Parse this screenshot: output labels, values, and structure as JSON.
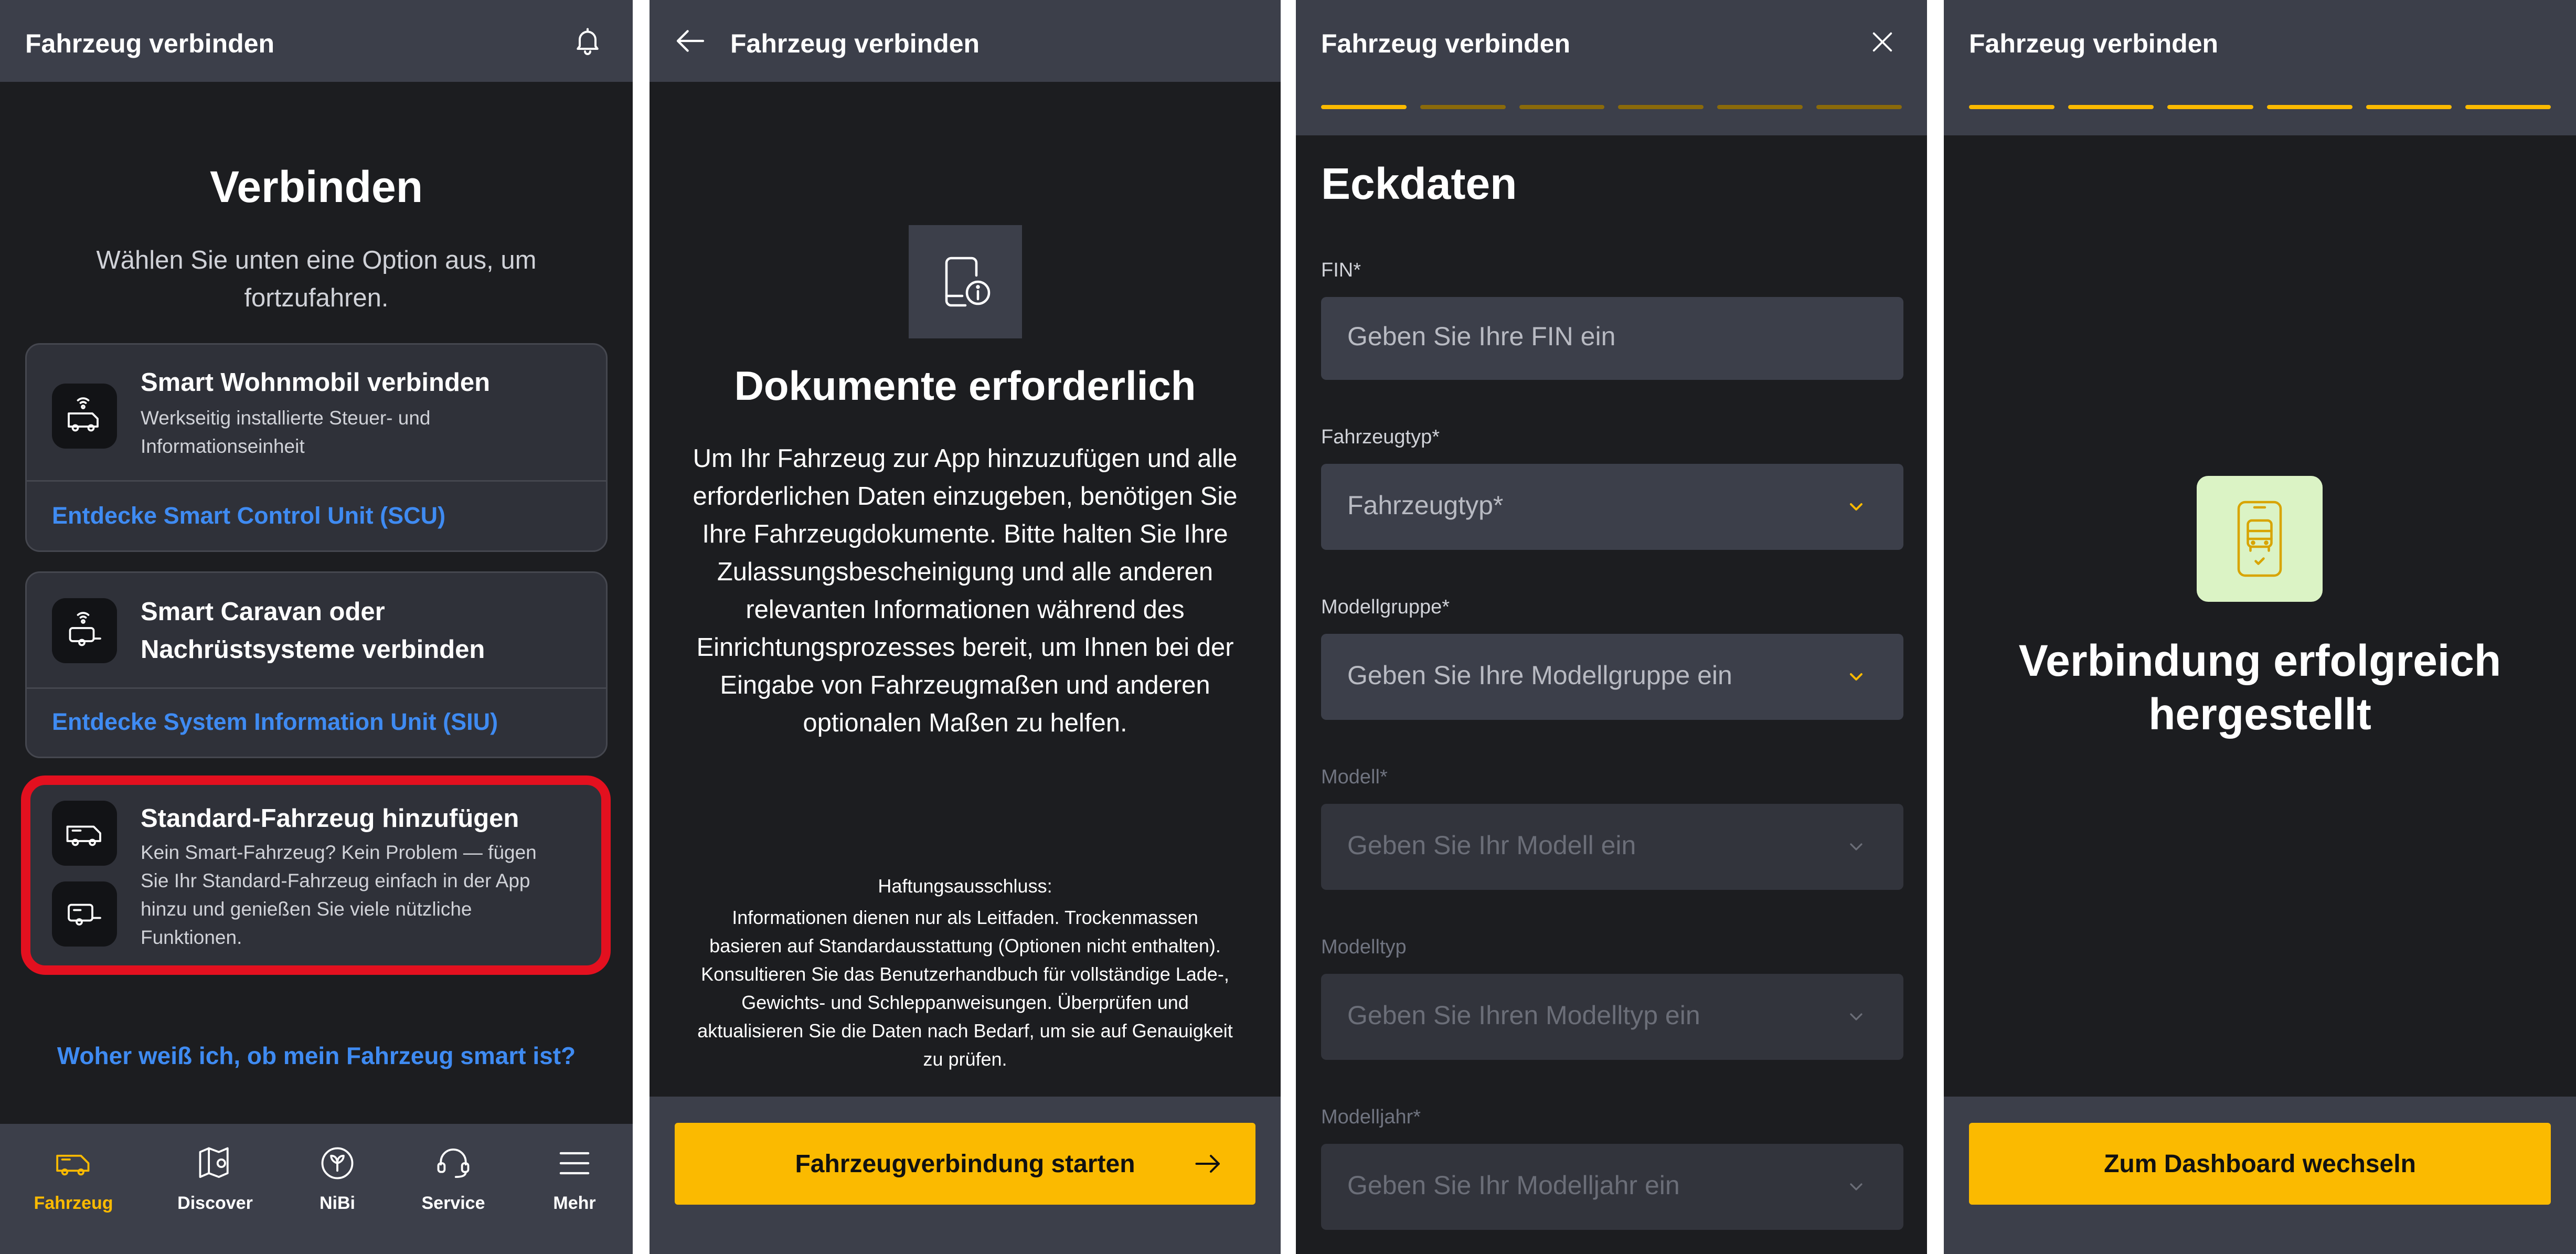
{
  "screen1": {
    "title": "Fahrzeug verbinden",
    "heading": "Verbinden",
    "subtitle": "Wählen Sie unten eine Option aus, um fortzufahren.",
    "card1": {
      "title": "Smart Wohnmobil verbinden",
      "desc_line1": "Werkseitig installierte Steuer- und",
      "desc_line2": "Informationseinheit",
      "link": "Entdecke Smart Control Unit (SCU)"
    },
    "card2": {
      "title_line1": "Smart Caravan oder",
      "title_line2": "Nachrüstsysteme verbinden",
      "link": "Entdecke System Information Unit (SIU)"
    },
    "card3": {
      "title": "Standard-Fahrzeug hinzufügen",
      "desc_line1": "Kein Smart-Fahrzeug? Kein Problem — fügen",
      "desc_line2": "Sie Ihr Standard-Fahrzeug einfach in der App",
      "desc_line3": "hinzu und genießen Sie viele nützliche",
      "desc_line4": "Funktionen."
    },
    "help_link": "Woher weiß ich, ob mein Fahrzeug smart ist?",
    "nav": [
      {
        "label": "Fahrzeug",
        "icon": "van-icon"
      },
      {
        "label": "Discover",
        "icon": "map-icon"
      },
      {
        "label": "NiBi",
        "icon": "nibi-icon"
      },
      {
        "label": "Service",
        "icon": "headset-icon"
      },
      {
        "label": "Mehr",
        "icon": "menu-icon"
      }
    ]
  },
  "screen2": {
    "title": "Fahrzeug verbinden",
    "heading": "Dokumente erforderlich",
    "body": "Um Ihr Fahrzeug zur App hinzuzufügen und alle erforderlichen Daten einzugeben, benötigen Sie Ihre Fahrzeugdokumente. Bitte halten Sie Ihre Zulassungsbescheinigung und alle anderen relevanten Informationen während des Einrichtungsprozesses bereit, um Ihnen bei der Eingabe von Fahrzeugmaßen und anderen optionalen Maßen zu helfen.",
    "disclaimer_title": "Haftungsausschluss:",
    "disclaimer_body": "Informationen dienen nur als Leitfaden. Trockenmassen basieren auf Standardausstattung (Optionen nicht enthalten). Konsultieren Sie das Benutzerhandbuch für vollständige Lade-, Gewichts- und Schleppanweisungen. Überprüfen und aktualisieren Sie die Daten nach Bedarf, um sie auf Genauigkeit zu prüfen.",
    "button": "Fahrzeugverbindung starten"
  },
  "screen3": {
    "title": "Fahrzeug verbinden",
    "progress_completed": 1,
    "progress_total": 6,
    "heading": "Eckdaten",
    "fields": [
      {
        "label": "FIN*",
        "placeholder": "Geben Sie Ihre FIN ein"
      },
      {
        "label": "Fahrzeugtyp*",
        "placeholder": "Fahrzeugtyp*"
      },
      {
        "label": "Modellgruppe*",
        "placeholder": "Geben Sie Ihre Modellgruppe ein"
      },
      {
        "label": "Modell*",
        "placeholder": "Geben Sie Ihr Modell ein"
      },
      {
        "label": "Modelltyp",
        "placeholder": "Geben Sie Ihren Modelltyp ein"
      },
      {
        "label": "Modelljahr*",
        "placeholder": "Geben Sie Ihr Modelljahr ein"
      }
    ]
  },
  "screen4": {
    "title": "Fahrzeug verbinden",
    "progress_completed": 6,
    "progress_total": 6,
    "heading": "Verbindung erfolgreich hergestellt",
    "button": "Zum Dashboard wechseln"
  },
  "colors": {
    "accent": "#fbba00",
    "link": "#3f8bf2",
    "highlight": "#e3101f",
    "background": "#1c1d20",
    "bar": "#3c3f4a"
  }
}
